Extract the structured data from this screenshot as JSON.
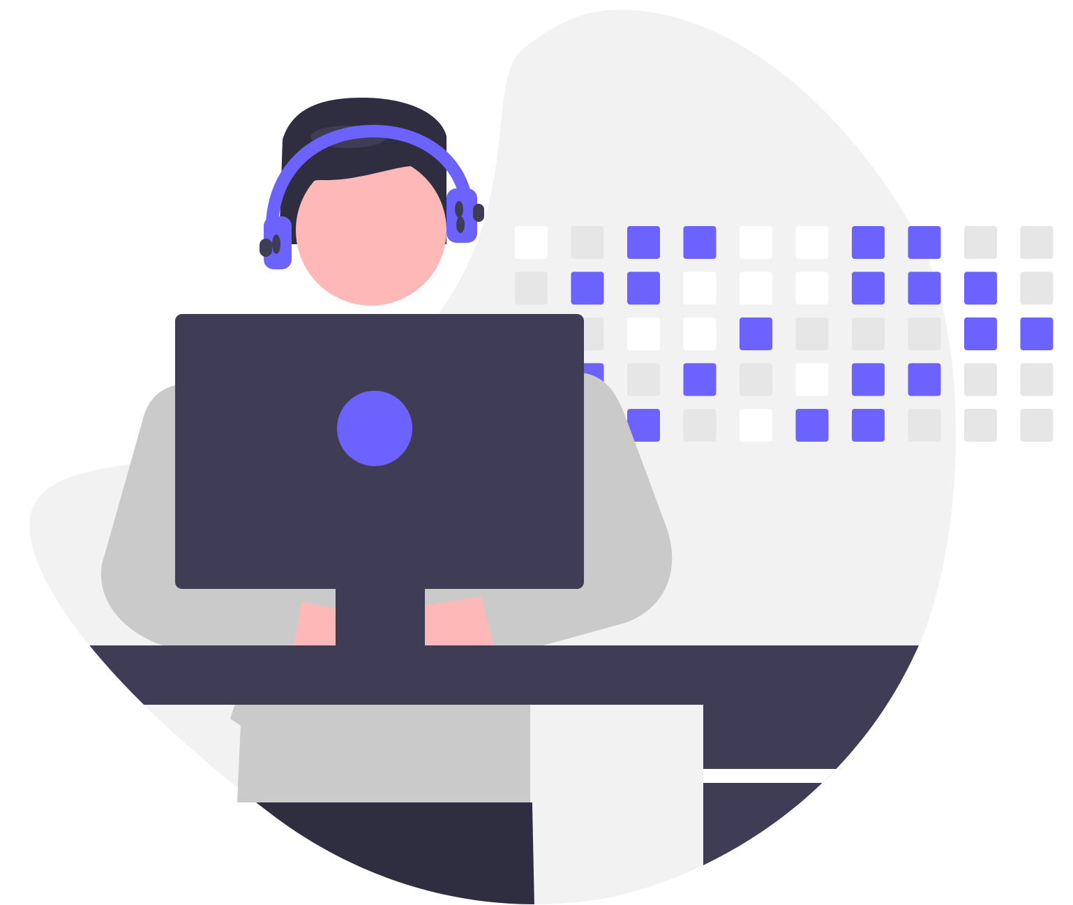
{
  "illustration": {
    "subject": "person-with-headset-at-computer",
    "colors": {
      "background": "#ffffff",
      "blob": "#f2f2f2",
      "accent": "#6c63ff",
      "dark": "#3f3d56",
      "darker": "#2f2e41",
      "skin": "#ffb8b8",
      "shirt": "#cacaca",
      "tile_light": "#e6e6e6",
      "tile_white": "#ffffff"
    },
    "tile_grid": {
      "rows": [
        [
          "w",
          "g",
          "p",
          "p",
          "w",
          "w",
          "p",
          "p",
          "g",
          "g"
        ],
        [
          "g",
          "p",
          "p",
          "w",
          "w",
          "w",
          "p",
          "p",
          "p",
          "g"
        ],
        [
          "p",
          "g",
          "w",
          "w",
          "p",
          "g",
          "g",
          "g",
          "p",
          "p"
        ],
        [
          "p",
          "p",
          "g",
          "p",
          "g",
          "w",
          "p",
          "p",
          "g",
          "g"
        ],
        [
          "p",
          "p",
          "p",
          "g",
          "w",
          "p",
          "p",
          "g",
          "g",
          "g"
        ]
      ]
    }
  }
}
